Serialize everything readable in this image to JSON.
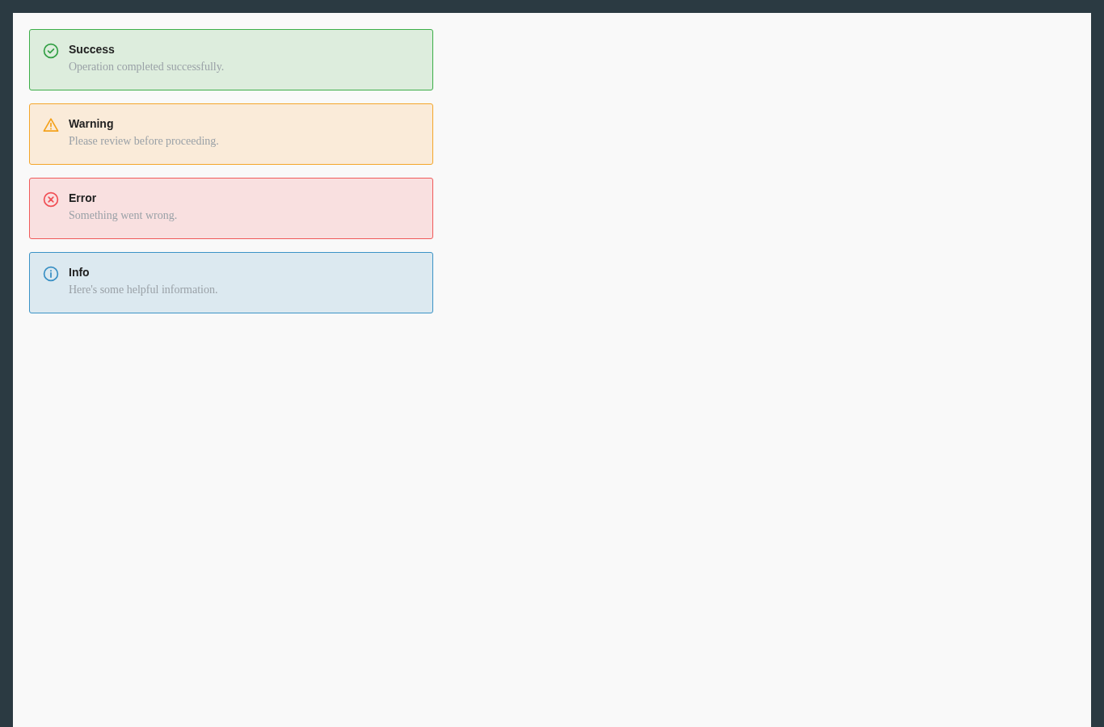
{
  "alerts": [
    {
      "kind": "success",
      "title": "Success",
      "message": "Operation completed successfully."
    },
    {
      "kind": "warning",
      "title": "Warning",
      "message": "Please review before proceeding."
    },
    {
      "kind": "error",
      "title": "Error",
      "message": "Something went wrong."
    },
    {
      "kind": "info",
      "title": "Info",
      "message": "Here's some helpful information."
    }
  ]
}
